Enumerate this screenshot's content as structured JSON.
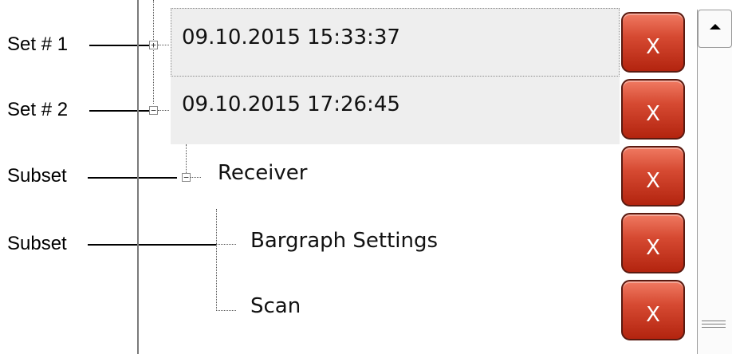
{
  "callouts": {
    "set1": "Set # 1",
    "set2": "Set # 2",
    "subset_receiver": "Subset",
    "subset_children": "Subset"
  },
  "tree": {
    "set1": {
      "text": "09.10.2015 15:33:37",
      "expander": "+",
      "selected": true
    },
    "set2": {
      "text": "09.10.2015 17:26:45",
      "expander": "−"
    },
    "receiver": {
      "text": "Receiver",
      "expander": "−"
    },
    "bargraph": {
      "text": "Bargraph Settings"
    },
    "scan": {
      "text": "Scan"
    }
  },
  "delete_buttons": {
    "label": "X"
  },
  "colors": {
    "delete_button": "#c8321c",
    "row_background": "#eeeeee"
  }
}
